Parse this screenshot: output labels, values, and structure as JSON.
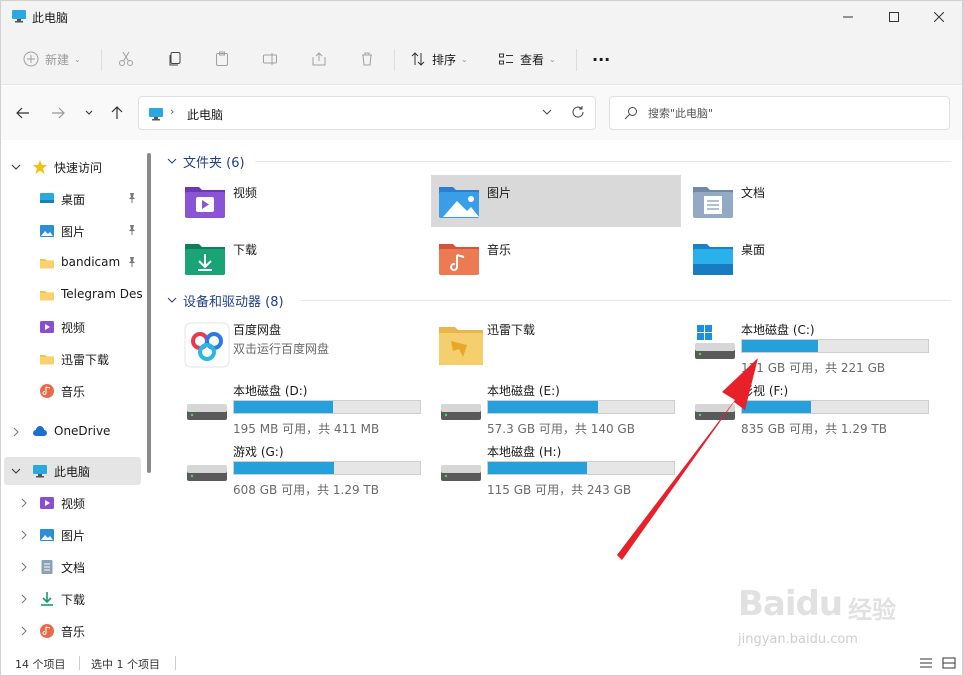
{
  "window": {
    "title": "此电脑"
  },
  "toolbar": {
    "new_label": "新建",
    "sort_label": "排序",
    "view_label": "查看",
    "more_label": "···"
  },
  "address": {
    "path": "此电脑",
    "search_placeholder": "搜索\"此电脑\""
  },
  "nav": {
    "quick_access": "快速访问",
    "quick_items": [
      {
        "label": "桌面",
        "icon": "desktop-icon",
        "pinned": true
      },
      {
        "label": "图片",
        "icon": "pictures-icon",
        "pinned": true
      },
      {
        "label": "bandicam",
        "icon": "folder-icon",
        "pinned": true
      },
      {
        "label": "Telegram Des",
        "icon": "folder-icon",
        "pinned": false
      },
      {
        "label": "视频",
        "icon": "videos-icon",
        "pinned": false
      },
      {
        "label": "迅雷下载",
        "icon": "folder-icon",
        "pinned": false
      },
      {
        "label": "音乐",
        "icon": "music-icon",
        "pinned": false
      }
    ],
    "onedrive": "OneDrive",
    "this_pc": "此电脑",
    "pc_items": [
      {
        "label": "视频",
        "icon": "videos-icon"
      },
      {
        "label": "图片",
        "icon": "pictures-icon"
      },
      {
        "label": "文档",
        "icon": "documents-icon"
      },
      {
        "label": "下载",
        "icon": "downloads-icon"
      },
      {
        "label": "音乐",
        "icon": "music-icon"
      }
    ]
  },
  "content": {
    "folders_header": "文件夹 (6)",
    "folders": [
      {
        "label": "视频",
        "icon": "videos-folder-icon"
      },
      {
        "label": "图片",
        "icon": "pictures-folder-icon",
        "selected": true
      },
      {
        "label": "文档",
        "icon": "documents-folder-icon"
      },
      {
        "label": "下载",
        "icon": "downloads-folder-icon"
      },
      {
        "label": "音乐",
        "icon": "music-folder-icon"
      },
      {
        "label": "桌面",
        "icon": "desktop-folder-icon"
      }
    ],
    "drives_header": "设备和驱动器 (8)",
    "drives": [
      {
        "label": "百度网盘",
        "sub": "双击运行百度网盘",
        "type": "app",
        "icon": "baidu-netdisk-icon"
      },
      {
        "label": "迅雷下载",
        "type": "folder",
        "icon": "xunlei-folder-icon"
      },
      {
        "label": "本地磁盘 (C:)",
        "free": "131 GB 可用，共 221 GB",
        "used_fraction": 0.41,
        "icon": "windows-drive-icon"
      },
      {
        "label": "本地磁盘 (D:)",
        "free": "195 MB 可用，共 411 MB",
        "used_fraction": 0.53,
        "icon": "hard-drive-icon"
      },
      {
        "label": "本地磁盘 (E:)",
        "free": "57.3 GB 可用，共 140 GB",
        "used_fraction": 0.59,
        "icon": "hard-drive-icon"
      },
      {
        "label": "影视 (F:)",
        "free": "835 GB 可用，共 1.29 TB",
        "used_fraction": 0.37,
        "icon": "hard-drive-icon"
      },
      {
        "label": "游戏 (G:)",
        "free": "608 GB 可用，共 1.29 TB",
        "used_fraction": 0.54,
        "icon": "hard-drive-icon"
      },
      {
        "label": "本地磁盘 (H:)",
        "free": "115 GB 可用，共 243 GB",
        "used_fraction": 0.53,
        "icon": "hard-drive-icon"
      }
    ]
  },
  "status": {
    "item_count": "14 个项目",
    "selected_count": "选中 1 个项目"
  },
  "watermark": {
    "brand": "Baidu",
    "brand_cn": "经验",
    "url": "jingyan.baidu.com"
  },
  "colors": {
    "accent": "#26a0da",
    "group_header": "#1f3f8a",
    "annotation_arrow": "#e8202a"
  }
}
